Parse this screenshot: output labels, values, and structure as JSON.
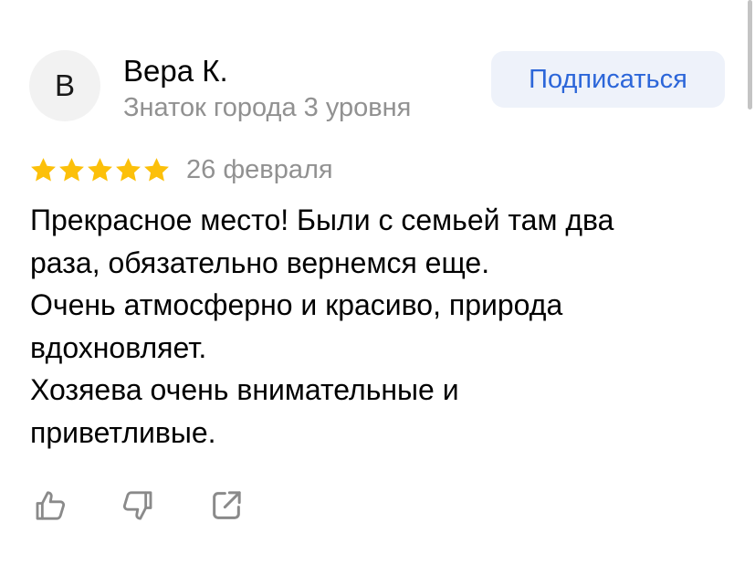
{
  "author": {
    "avatar_letter": "В",
    "name": "Вера К.",
    "level": "Знаток города 3 уровня"
  },
  "subscribe_button": {
    "label": "Подписаться"
  },
  "review": {
    "rating": 5,
    "max_rating": 5,
    "date": "26 февраля",
    "text_lines": [
      "Прекрасное место! Были с семьей там два",
      "раза, обязательно вернемся еще.",
      "Очень атмосферно и красиво, природа",
      "вдохновляет.",
      "Хозяева очень внимательные и",
      "приветливые."
    ]
  },
  "actions": {
    "like_icon": "thumbs-up-icon",
    "dislike_icon": "thumbs-down-icon",
    "share_icon": "share-icon"
  },
  "colors": {
    "star": "#fcc00a",
    "accent": "#2c66d9",
    "button_bg": "#eef2fa",
    "secondary_text": "#919191",
    "icon": "#8a8a8a"
  }
}
